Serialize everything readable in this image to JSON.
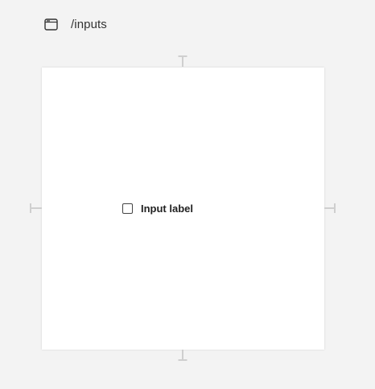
{
  "header": {
    "route": "/inputs",
    "icon": "browser-window-icon"
  },
  "canvas": {
    "checkbox": {
      "label": "Input label",
      "checked": false
    }
  },
  "colors": {
    "background": "#f3f3f3",
    "canvas": "#ffffff",
    "handle": "#cccccc",
    "text": "#222222"
  }
}
